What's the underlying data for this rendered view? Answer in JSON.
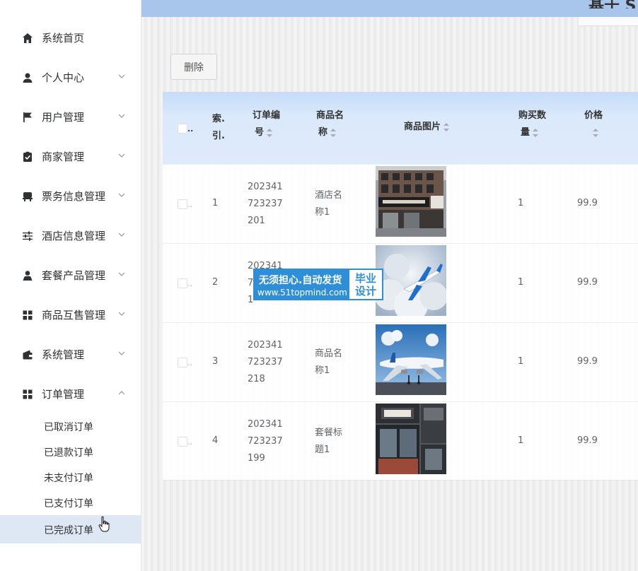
{
  "sidebar": {
    "items": [
      {
        "label": "系统首页",
        "icon": "home-icon",
        "has_arrow": false
      },
      {
        "label": "个人中心",
        "icon": "user-icon",
        "has_arrow": true
      },
      {
        "label": "用户管理",
        "icon": "flag-icon",
        "has_arrow": true
      },
      {
        "label": "商家管理",
        "icon": "clipboard-check-icon",
        "has_arrow": true
      },
      {
        "label": "票务信息管理",
        "icon": "ticket-icon",
        "has_arrow": true
      },
      {
        "label": "酒店信息管理",
        "icon": "sliders-icon",
        "has_arrow": true
      },
      {
        "label": "套餐产品管理",
        "icon": "person-icon",
        "has_arrow": true
      },
      {
        "label": "商品互售管理",
        "icon": "grid-icon",
        "has_arrow": true
      },
      {
        "label": "系统管理",
        "icon": "wallet-icon",
        "has_arrow": true
      },
      {
        "label": "订单管理",
        "icon": "grid-icon",
        "has_arrow": true,
        "expanded": true
      }
    ],
    "submenu": [
      {
        "label": "已取消订单"
      },
      {
        "label": "已退款订单"
      },
      {
        "label": "未支付订单"
      },
      {
        "label": "已支付订单"
      },
      {
        "label": "已完成订单",
        "active": true
      }
    ]
  },
  "header": {
    "title_fragment": "基于 S"
  },
  "toolbar": {
    "delete_label": "删除"
  },
  "table": {
    "headers": {
      "index": [
        "索.",
        "引."
      ],
      "order_no": [
        "订单编",
        "号"
      ],
      "product_name": [
        "商品名",
        "称"
      ],
      "product_image": "商品图片",
      "quantity": [
        "购买数",
        "量"
      ],
      "price": "价格"
    },
    "checkbox_ellipsis": "..",
    "rows": [
      {
        "index": "1",
        "order_no": [
          "202341",
          "723237",
          "201"
        ],
        "name": [
          "酒店名",
          "称1"
        ],
        "image": "hotel-photo",
        "qty": "1",
        "price": "99.9"
      },
      {
        "index": "2",
        "order_no": [
          "202341",
          "7",
          "1"
        ],
        "name": [
          "",
          ""
        ],
        "image": "plane-clouds-photo",
        "qty": "1",
        "price": "99.9"
      },
      {
        "index": "3",
        "order_no": [
          "202341",
          "723237",
          "218"
        ],
        "name": [
          "商品名",
          "称1"
        ],
        "image": "plane-runway-photo",
        "qty": "1",
        "price": "99.9"
      },
      {
        "index": "4",
        "order_no": [
          "202341",
          "723237",
          "199"
        ],
        "name": [
          "套餐标",
          "题1"
        ],
        "image": "hotel-front-photo",
        "qty": "1",
        "price": "99.9"
      }
    ]
  },
  "watermark": {
    "line1": "无须担心.自动发货",
    "line2": "www.51topmind.com",
    "right1": "毕业",
    "right2": "设计"
  },
  "colors": {
    "topbar": "#a8c6ec",
    "header_gradient_top": "#c5dcf8",
    "active_submenu": "#dde8f4",
    "watermark": "#2f8fd6"
  }
}
